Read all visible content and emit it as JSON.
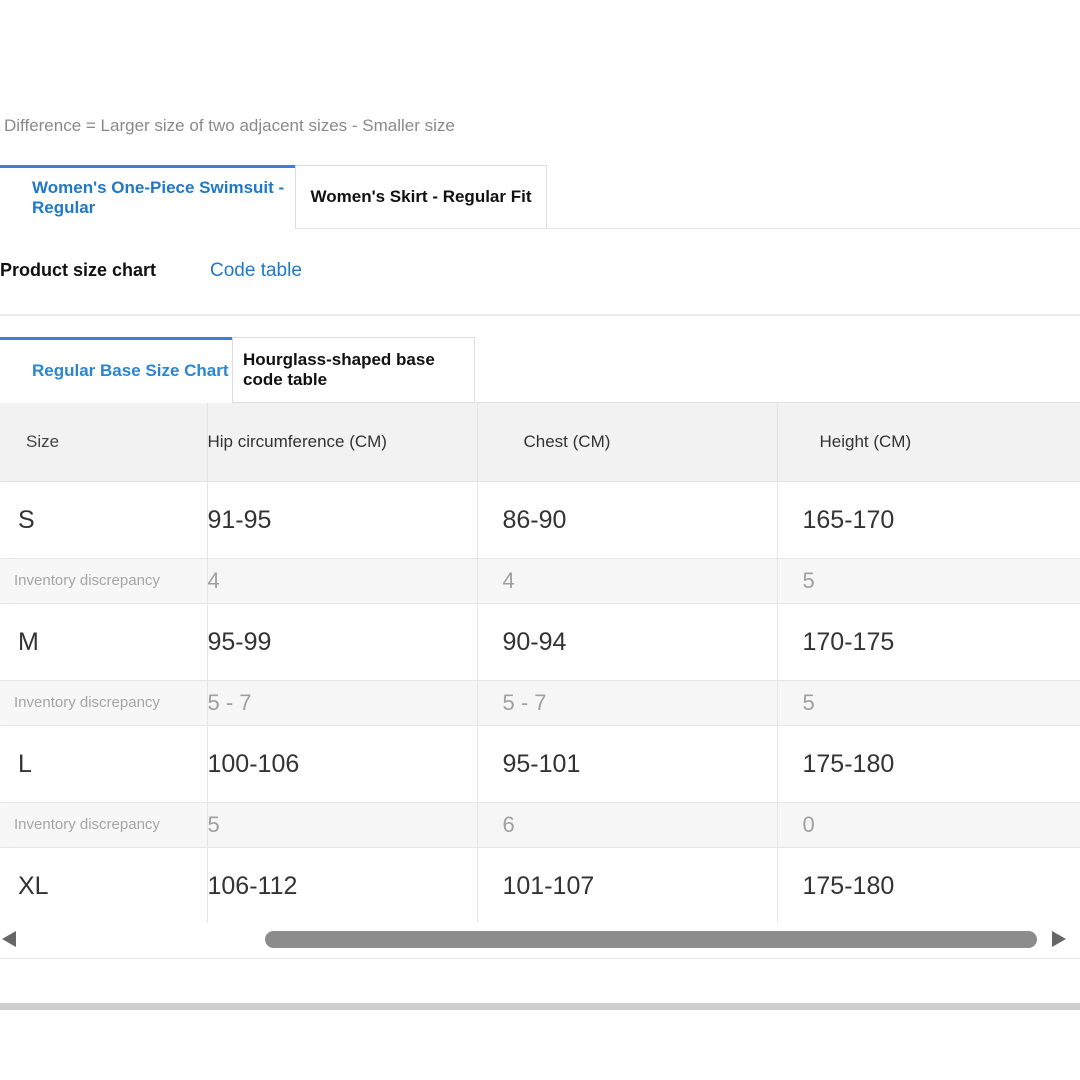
{
  "note": "Difference = Larger size of two adjacent sizes - Smaller size",
  "product_tabs": [
    {
      "label": "Women's One-Piece Swimsuit - Regular",
      "active": true
    },
    {
      "label": "Women's Skirt - Regular Fit",
      "active": false
    }
  ],
  "view_tabs": [
    {
      "label": "Product size chart",
      "active": false
    },
    {
      "label": "Code table",
      "active": true
    }
  ],
  "chart_tabs": [
    {
      "label": "Regular Base Size Chart",
      "active": true
    },
    {
      "label": "Hourglass-shaped base code table",
      "active": false
    }
  ],
  "table": {
    "headers": [
      "Size",
      "Hip circumference (CM)",
      "Chest (CM)",
      "Height (CM)"
    ],
    "rows": [
      {
        "type": "size",
        "cells": [
          "S",
          "91-95",
          "86-90",
          "165-170"
        ]
      },
      {
        "type": "diff",
        "cells": [
          "Inventory discrepancy",
          "4",
          "4",
          "5"
        ]
      },
      {
        "type": "size",
        "cells": [
          "M",
          "95-99",
          "90-94",
          "170-175"
        ]
      },
      {
        "type": "diff",
        "cells": [
          "Inventory discrepancy",
          "5 - 7",
          "5 - 7",
          "5"
        ]
      },
      {
        "type": "size",
        "cells": [
          "L",
          "100-106",
          "95-101",
          "175-180"
        ]
      },
      {
        "type": "diff",
        "cells": [
          "Inventory discrepancy",
          "5",
          "6",
          "0"
        ]
      },
      {
        "type": "size",
        "cells": [
          "XL",
          "106-112",
          "101-107",
          "175-180"
        ]
      }
    ]
  },
  "colors": {
    "accent": "#1f78c8",
    "tab_border": "#3b7fd6"
  }
}
